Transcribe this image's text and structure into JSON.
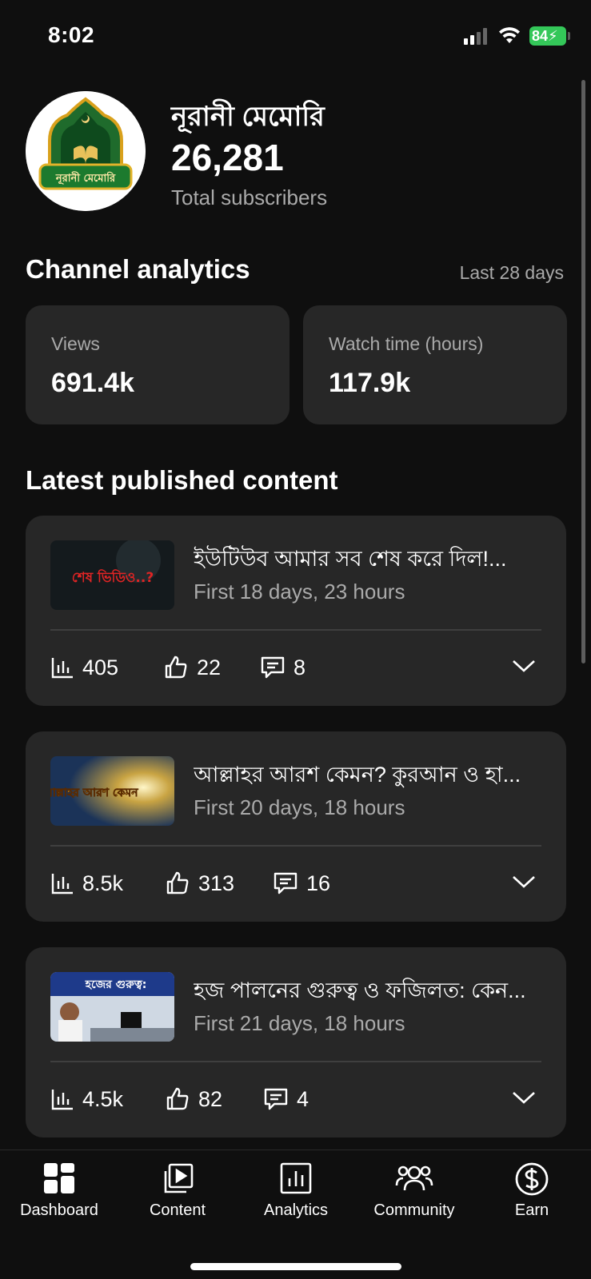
{
  "status_bar": {
    "time": "8:02",
    "battery": "84"
  },
  "channel": {
    "name": "নূরানী মেমোরি",
    "logo_text": "নূরানী মেমোরি",
    "subscribers": "26,281",
    "subscribers_label": "Total subscribers"
  },
  "analytics": {
    "title": "Channel analytics",
    "period": "Last 28 days",
    "cards": [
      {
        "label": "Views",
        "value": "691.4k"
      },
      {
        "label": "Watch time (hours)",
        "value": "117.9k"
      }
    ]
  },
  "latest": {
    "title": "Latest published content",
    "items": [
      {
        "title": "ইউটিউব আমার সব শেষ করে দিল!...",
        "subtitle": "First 18 days, 23 hours",
        "thumb_text": "শেষ ভিডিও..?",
        "views": "405",
        "likes": "22",
        "comments": "8"
      },
      {
        "title": "আল্লাহর আরশ কেমন? কুরআন ও হা...",
        "subtitle": "First 20 days, 18 hours",
        "thumb_text": "আল্লাহর আরশ কেমন",
        "views": "8.5k",
        "likes": "313",
        "comments": "16"
      },
      {
        "title": "হজ পালনের গুরুত্ব ও ফজিলত: কেন...",
        "subtitle": "First 21 days, 18 hours",
        "thumb_text": "হজের গুরুত্ব:",
        "views": "4.5k",
        "likes": "82",
        "comments": "4"
      }
    ]
  },
  "nav": [
    {
      "label": "Dashboard",
      "icon": "dashboard-icon"
    },
    {
      "label": "Content",
      "icon": "content-icon"
    },
    {
      "label": "Analytics",
      "icon": "analytics-icon"
    },
    {
      "label": "Community",
      "icon": "community-icon"
    },
    {
      "label": "Earn",
      "icon": "earn-icon"
    }
  ],
  "colors": {
    "background": "#0f0f0f",
    "card": "#272727",
    "muted": "#aaaaaa",
    "battery": "#34c759"
  }
}
